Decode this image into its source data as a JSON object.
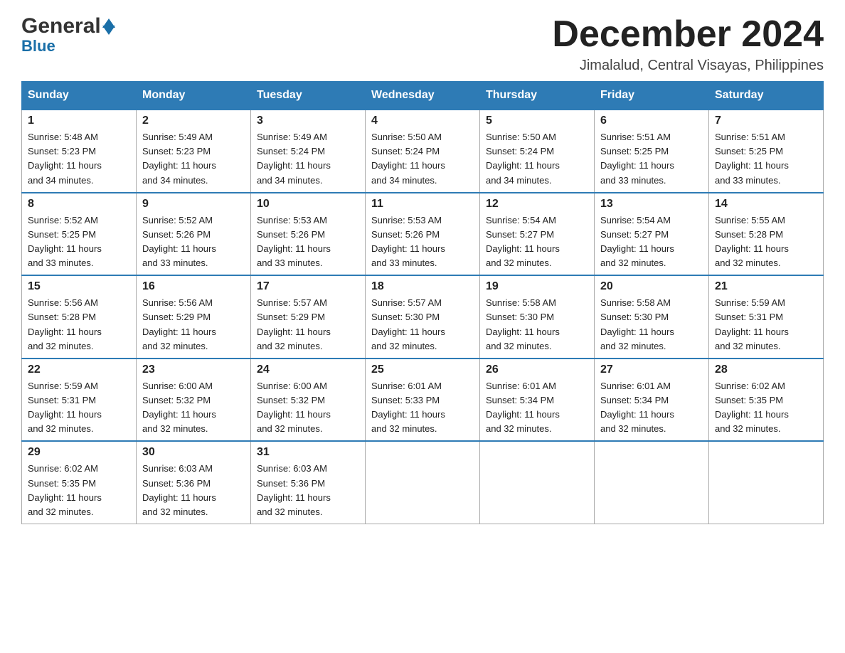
{
  "header": {
    "logo_general": "General",
    "logo_blue": "Blue",
    "month_title": "December 2024",
    "location": "Jimalalud, Central Visayas, Philippines"
  },
  "days_of_week": [
    "Sunday",
    "Monday",
    "Tuesday",
    "Wednesday",
    "Thursday",
    "Friday",
    "Saturday"
  ],
  "weeks": [
    [
      {
        "day": "1",
        "sunrise": "5:48 AM",
        "sunset": "5:23 PM",
        "daylight": "11 hours and 34 minutes."
      },
      {
        "day": "2",
        "sunrise": "5:49 AM",
        "sunset": "5:23 PM",
        "daylight": "11 hours and 34 minutes."
      },
      {
        "day": "3",
        "sunrise": "5:49 AM",
        "sunset": "5:24 PM",
        "daylight": "11 hours and 34 minutes."
      },
      {
        "day": "4",
        "sunrise": "5:50 AM",
        "sunset": "5:24 PM",
        "daylight": "11 hours and 34 minutes."
      },
      {
        "day": "5",
        "sunrise": "5:50 AM",
        "sunset": "5:24 PM",
        "daylight": "11 hours and 34 minutes."
      },
      {
        "day": "6",
        "sunrise": "5:51 AM",
        "sunset": "5:25 PM",
        "daylight": "11 hours and 33 minutes."
      },
      {
        "day": "7",
        "sunrise": "5:51 AM",
        "sunset": "5:25 PM",
        "daylight": "11 hours and 33 minutes."
      }
    ],
    [
      {
        "day": "8",
        "sunrise": "5:52 AM",
        "sunset": "5:25 PM",
        "daylight": "11 hours and 33 minutes."
      },
      {
        "day": "9",
        "sunrise": "5:52 AM",
        "sunset": "5:26 PM",
        "daylight": "11 hours and 33 minutes."
      },
      {
        "day": "10",
        "sunrise": "5:53 AM",
        "sunset": "5:26 PM",
        "daylight": "11 hours and 33 minutes."
      },
      {
        "day": "11",
        "sunrise": "5:53 AM",
        "sunset": "5:26 PM",
        "daylight": "11 hours and 33 minutes."
      },
      {
        "day": "12",
        "sunrise": "5:54 AM",
        "sunset": "5:27 PM",
        "daylight": "11 hours and 32 minutes."
      },
      {
        "day": "13",
        "sunrise": "5:54 AM",
        "sunset": "5:27 PM",
        "daylight": "11 hours and 32 minutes."
      },
      {
        "day": "14",
        "sunrise": "5:55 AM",
        "sunset": "5:28 PM",
        "daylight": "11 hours and 32 minutes."
      }
    ],
    [
      {
        "day": "15",
        "sunrise": "5:56 AM",
        "sunset": "5:28 PM",
        "daylight": "11 hours and 32 minutes."
      },
      {
        "day": "16",
        "sunrise": "5:56 AM",
        "sunset": "5:29 PM",
        "daylight": "11 hours and 32 minutes."
      },
      {
        "day": "17",
        "sunrise": "5:57 AM",
        "sunset": "5:29 PM",
        "daylight": "11 hours and 32 minutes."
      },
      {
        "day": "18",
        "sunrise": "5:57 AM",
        "sunset": "5:30 PM",
        "daylight": "11 hours and 32 minutes."
      },
      {
        "day": "19",
        "sunrise": "5:58 AM",
        "sunset": "5:30 PM",
        "daylight": "11 hours and 32 minutes."
      },
      {
        "day": "20",
        "sunrise": "5:58 AM",
        "sunset": "5:30 PM",
        "daylight": "11 hours and 32 minutes."
      },
      {
        "day": "21",
        "sunrise": "5:59 AM",
        "sunset": "5:31 PM",
        "daylight": "11 hours and 32 minutes."
      }
    ],
    [
      {
        "day": "22",
        "sunrise": "5:59 AM",
        "sunset": "5:31 PM",
        "daylight": "11 hours and 32 minutes."
      },
      {
        "day": "23",
        "sunrise": "6:00 AM",
        "sunset": "5:32 PM",
        "daylight": "11 hours and 32 minutes."
      },
      {
        "day": "24",
        "sunrise": "6:00 AM",
        "sunset": "5:32 PM",
        "daylight": "11 hours and 32 minutes."
      },
      {
        "day": "25",
        "sunrise": "6:01 AM",
        "sunset": "5:33 PM",
        "daylight": "11 hours and 32 minutes."
      },
      {
        "day": "26",
        "sunrise": "6:01 AM",
        "sunset": "5:34 PM",
        "daylight": "11 hours and 32 minutes."
      },
      {
        "day": "27",
        "sunrise": "6:01 AM",
        "sunset": "5:34 PM",
        "daylight": "11 hours and 32 minutes."
      },
      {
        "day": "28",
        "sunrise": "6:02 AM",
        "sunset": "5:35 PM",
        "daylight": "11 hours and 32 minutes."
      }
    ],
    [
      {
        "day": "29",
        "sunrise": "6:02 AM",
        "sunset": "5:35 PM",
        "daylight": "11 hours and 32 minutes."
      },
      {
        "day": "30",
        "sunrise": "6:03 AM",
        "sunset": "5:36 PM",
        "daylight": "11 hours and 32 minutes."
      },
      {
        "day": "31",
        "sunrise": "6:03 AM",
        "sunset": "5:36 PM",
        "daylight": "11 hours and 32 minutes."
      },
      null,
      null,
      null,
      null
    ]
  ],
  "labels": {
    "sunrise": "Sunrise:",
    "sunset": "Sunset:",
    "daylight": "Daylight:"
  }
}
